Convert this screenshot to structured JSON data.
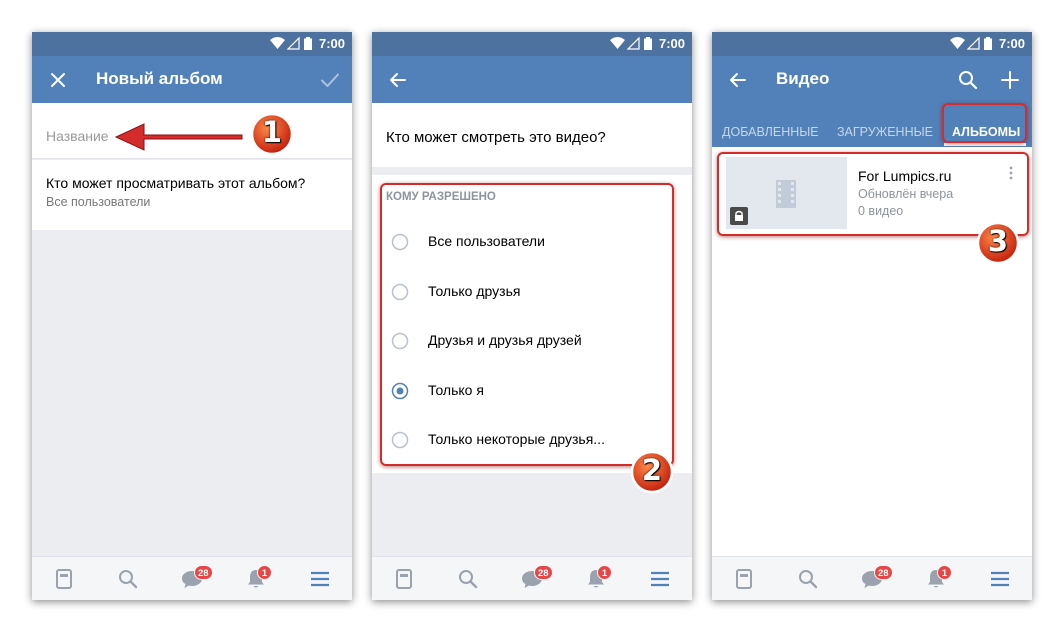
{
  "status_bar": {
    "time": "7:00"
  },
  "screen1": {
    "title": "Новый альбом",
    "name_placeholder": "Название",
    "privacy_title": "Кто может просматривать этот альбом?",
    "privacy_value": "Все пользователи"
  },
  "screen2": {
    "question": "Кто может смотреть это видео?",
    "section_header": "КОМУ РАЗРЕШЕНО",
    "options": [
      {
        "label": "Все пользователи",
        "selected": false
      },
      {
        "label": "Только друзья",
        "selected": false
      },
      {
        "label": "Друзья и друзья друзей",
        "selected": false
      },
      {
        "label": "Только я",
        "selected": true
      },
      {
        "label": "Только некоторые друзья...",
        "selected": false
      }
    ]
  },
  "screen3": {
    "title": "Видео",
    "tabs": [
      "ДОБАВЛЕННЫЕ",
      "ЗАГРУЖЕННЫЕ",
      "АЛЬБОМЫ"
    ],
    "active_tab": "АЛЬБОМЫ",
    "album": {
      "name": "For Lumpics.ru",
      "updated": "Обновлён вчера",
      "count": "0 видео"
    }
  },
  "bottom_nav": {
    "messages_badge": "28",
    "notifications_badge": "1"
  },
  "annotations": [
    "1",
    "2",
    "3"
  ],
  "colors": {
    "header": "#5181b8",
    "status_bar": "#4d72a0",
    "accent_red": "#d42b2b",
    "radio_selected": "#5181b8"
  }
}
